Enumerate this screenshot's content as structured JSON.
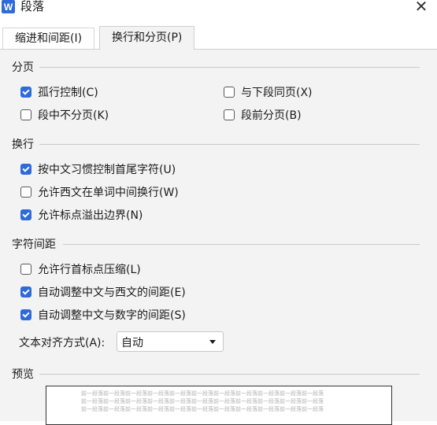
{
  "window": {
    "title": "段落",
    "app_icon": "W"
  },
  "tabs": [
    {
      "label": "缩进和间距(I)",
      "active": false
    },
    {
      "label": "换行和分页(P)",
      "active": true
    }
  ],
  "pagination": {
    "title": "分页",
    "options": [
      {
        "label": "孤行控制(C)",
        "checked": true
      },
      {
        "label": "与下段同页(X)",
        "checked": false
      },
      {
        "label": "段中不分页(K)",
        "checked": false
      },
      {
        "label": "段前分页(B)",
        "checked": false
      }
    ]
  },
  "line_break": {
    "title": "换行",
    "options": [
      {
        "label": "按中文习惯控制首尾字符(U)",
        "checked": true
      },
      {
        "label": "允许西文在单词中间换行(W)",
        "checked": false
      },
      {
        "label": "允许标点溢出边界(N)",
        "checked": true
      }
    ]
  },
  "char_spacing": {
    "title": "字符间距",
    "options": [
      {
        "label": "允许行首标点压缩(L)",
        "checked": false
      },
      {
        "label": "自动调整中文与西文的间距(E)",
        "checked": true
      },
      {
        "label": "自动调整中文与数字的间距(S)",
        "checked": true
      }
    ]
  },
  "text_align": {
    "label": "文本对齐方式(A):",
    "value": "自动"
  },
  "preview": {
    "title": "预览",
    "lines": [
      "前一段落前一段落前一段落前一段落前一段落前一段落前一段落前一段落前一段落前一段落前一段落",
      "前一段落前一段落前一段落前一段落前一段落前一段落前一段落前一段落前一段落前一段落前一段落",
      "前一段落前一段落前一段落前一段落前一段落前一段落前一段落前一段落前一段落前一段落前一段落"
    ]
  },
  "colors": {
    "accent": "#2f6bd8",
    "panel_bg": "#f3f3f3"
  }
}
